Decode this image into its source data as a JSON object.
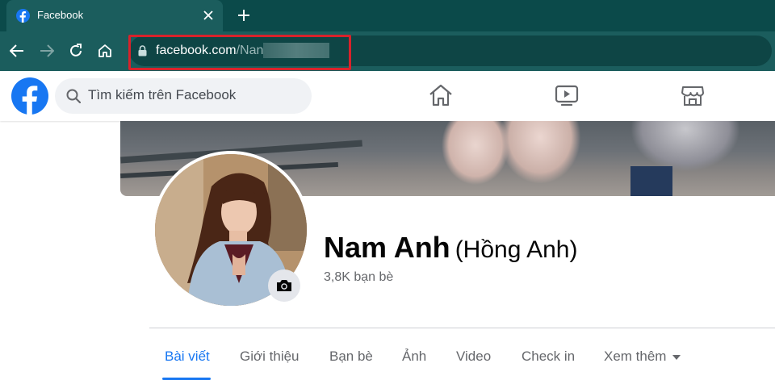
{
  "browser": {
    "tab_title": "Facebook",
    "url_domain": "facebook.com",
    "url_path": "/Nan",
    "highlight_color": "#d8222b"
  },
  "header": {
    "search_placeholder": "Tìm kiếm trên Facebook",
    "nav_icons": [
      "home-icon",
      "watch-icon",
      "marketplace-icon"
    ],
    "brand_color": "#1877f2"
  },
  "profile": {
    "name": "Nam Anh",
    "alt_name": "(Hồng Anh)",
    "friends": "3,8K bạn bè"
  },
  "tabs": [
    {
      "label": "Bài viết",
      "active": true
    },
    {
      "label": "Giới thiệu",
      "active": false
    },
    {
      "label": "Bạn bè",
      "active": false
    },
    {
      "label": "Ảnh",
      "active": false
    },
    {
      "label": "Video",
      "active": false
    },
    {
      "label": "Check in",
      "active": false
    },
    {
      "label": "Xem thêm",
      "active": false
    }
  ]
}
